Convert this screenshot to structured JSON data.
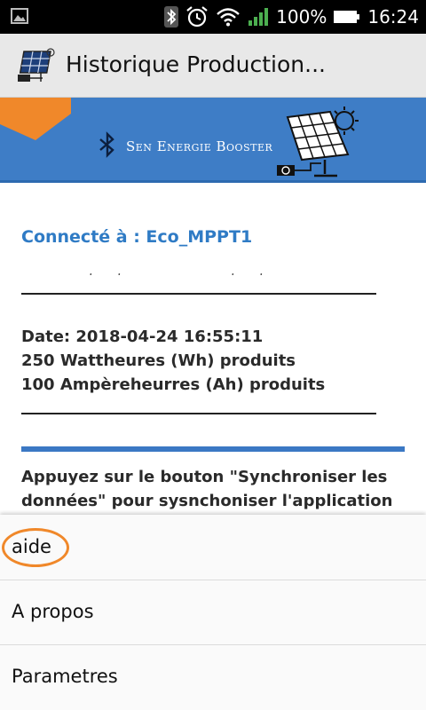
{
  "status_bar": {
    "battery_percent_label": "100%",
    "time": "16:24",
    "icons": [
      "image-icon",
      "bluetooth-icon",
      "alarm-icon",
      "wifi-icon",
      "signal-icon",
      "battery-icon"
    ]
  },
  "action_bar": {
    "title": "Historique Production...",
    "app_icon": "solar-panel-icon"
  },
  "banner": {
    "brand": "Sen Energie Booster",
    "colors": {
      "background": "#3e7dc6",
      "accent": "#f0882a"
    }
  },
  "content": {
    "connected_label": "Connecté à : Eco_MPPT1",
    "date_line": "Date: 2018-04-24 16:55:11",
    "wh_line": "250 Wattheures (Wh) produits",
    "ah_line": "100 Ampèreheurres (Ah) produits",
    "instructions": "Appuyez sur le bouton \"Synchroniser les données\" pour sysnchoniser l'application"
  },
  "menu": {
    "items": [
      {
        "label": "aide",
        "highlighted": true
      },
      {
        "label": "A propos"
      },
      {
        "label": "Parametres"
      }
    ],
    "highlight_color": "#f0882a"
  }
}
